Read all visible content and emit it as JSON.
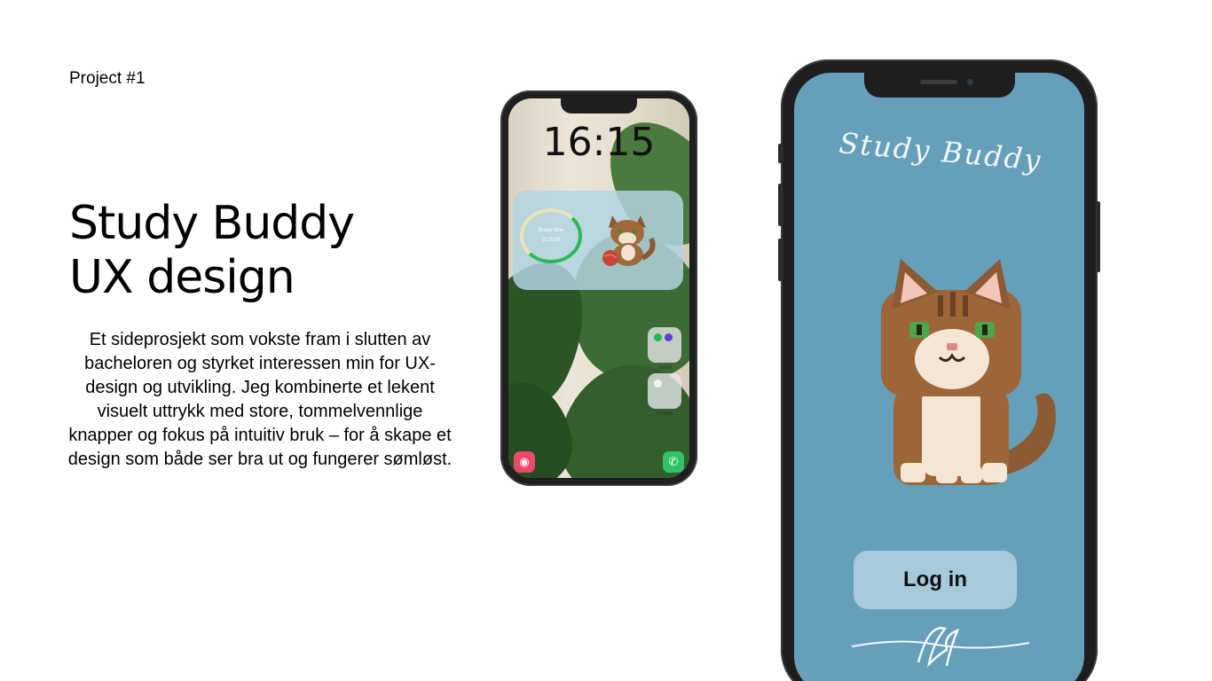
{
  "project_label": "Project #1",
  "title_line1": "Study Buddy",
  "title_line2": "UX design",
  "description": "Et sideprosjekt som vokste fram i slutten av bacheloren og styrket interessen min for UX-design og utvikling. Jeg kombinerte et lekent visuelt uttrykk med store, tommelvennlige knapper og fokus på intuitiv bruk – for å skape et design som både ser bra ut og fungerer sømløst.",
  "lockscreen": {
    "time": "16:15",
    "widget": {
      "label": "Break time",
      "timer": "0:15:00"
    },
    "folder_labels": [
      "Social",
      "Google"
    ],
    "dock": [
      "camera-icon",
      "phone-icon"
    ]
  },
  "app": {
    "title": "Study Buddy",
    "login_label": "Log in"
  },
  "colors": {
    "app_background": "#659fba",
    "login_button": "#a7cadb",
    "widget": "#b2d4e0",
    "timer_ring_progress": "#2fb85b"
  }
}
